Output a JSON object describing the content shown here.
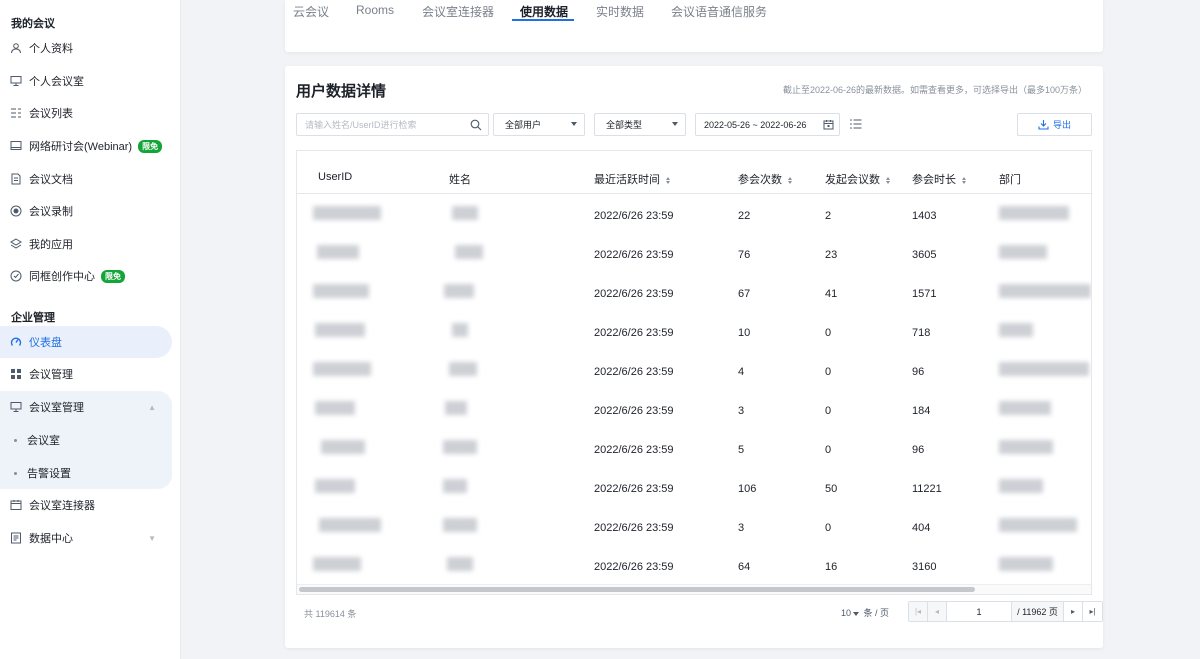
{
  "sidebar": {
    "section_my": "我的会议",
    "section_enterprise": "企业管理",
    "items": [
      {
        "label": "个人资料",
        "icon": "user-icon"
      },
      {
        "label": "个人会议室",
        "icon": "meeting-room-icon"
      },
      {
        "label": "会议列表",
        "icon": "list-icon"
      },
      {
        "label": "网络研讨会(Webinar)",
        "icon": "monitor-icon",
        "badge": "限免"
      },
      {
        "label": "会议文档",
        "icon": "document-icon"
      },
      {
        "label": "会议录制",
        "icon": "record-icon"
      },
      {
        "label": "我的应用",
        "icon": "layers-icon"
      },
      {
        "label": "同框创作中心",
        "icon": "frame-icon",
        "badge": "限免"
      },
      {
        "label": "仪表盘",
        "icon": "dashboard-icon"
      },
      {
        "label": "会议管理",
        "icon": "grid-icon"
      },
      {
        "label": "会议室管理",
        "icon": "meeting-room-icon"
      },
      {
        "label": "会议室",
        "icon": "dot-icon"
      },
      {
        "label": "告警设置",
        "icon": "dot-icon"
      },
      {
        "label": "会议室连接器",
        "icon": "connector-icon"
      },
      {
        "label": "数据中心",
        "icon": "data-icon"
      }
    ]
  },
  "tabs": [
    "云会议",
    "Rooms",
    "会议室连接器",
    "使用数据",
    "实时数据",
    "会议语音通信服务"
  ],
  "main": {
    "title": "用户数据详情",
    "note": "截止至2022-06-26的最新数据。如需查看更多，可选择导出（最多100万条）",
    "search_placeholder": "请输入姓名/UserID进行检索",
    "filter_user": "全部用户",
    "filter_type": "全部类型",
    "date_range": "2022-05-26 ~ 2022-06-26",
    "export_label": "导出"
  },
  "table": {
    "columns": [
      "UserID",
      "姓名",
      "最近活跃时间",
      "参会次数",
      "发起会议数",
      "参会时长",
      "部门"
    ],
    "rows": [
      {
        "time": "2022/6/26 23:59",
        "count": "22",
        "initiated": "2",
        "duration": "1403"
      },
      {
        "time": "2022/6/26 23:59",
        "count": "76",
        "initiated": "23",
        "duration": "3605"
      },
      {
        "time": "2022/6/26 23:59",
        "count": "67",
        "initiated": "41",
        "duration": "1571"
      },
      {
        "time": "2022/6/26 23:59",
        "count": "10",
        "initiated": "0",
        "duration": "718"
      },
      {
        "time": "2022/6/26 23:59",
        "count": "4",
        "initiated": "0",
        "duration": "96"
      },
      {
        "time": "2022/6/26 23:59",
        "count": "3",
        "initiated": "0",
        "duration": "184"
      },
      {
        "time": "2022/6/26 23:59",
        "count": "5",
        "initiated": "0",
        "duration": "96"
      },
      {
        "time": "2022/6/26 23:59",
        "count": "106",
        "initiated": "50",
        "duration": "11221"
      },
      {
        "time": "2022/6/26 23:59",
        "count": "3",
        "initiated": "0",
        "duration": "404"
      },
      {
        "time": "2022/6/26 23:59",
        "count": "64",
        "initiated": "16",
        "duration": "3160"
      }
    ]
  },
  "pagination": {
    "total": "共 119614 条",
    "page_size": "10",
    "page_size_unit": "条 / 页",
    "current_page": "1",
    "total_pages": "/ 11962 页"
  },
  "colors": {
    "accent": "#1f6fe5",
    "badge": "#13a538"
  }
}
